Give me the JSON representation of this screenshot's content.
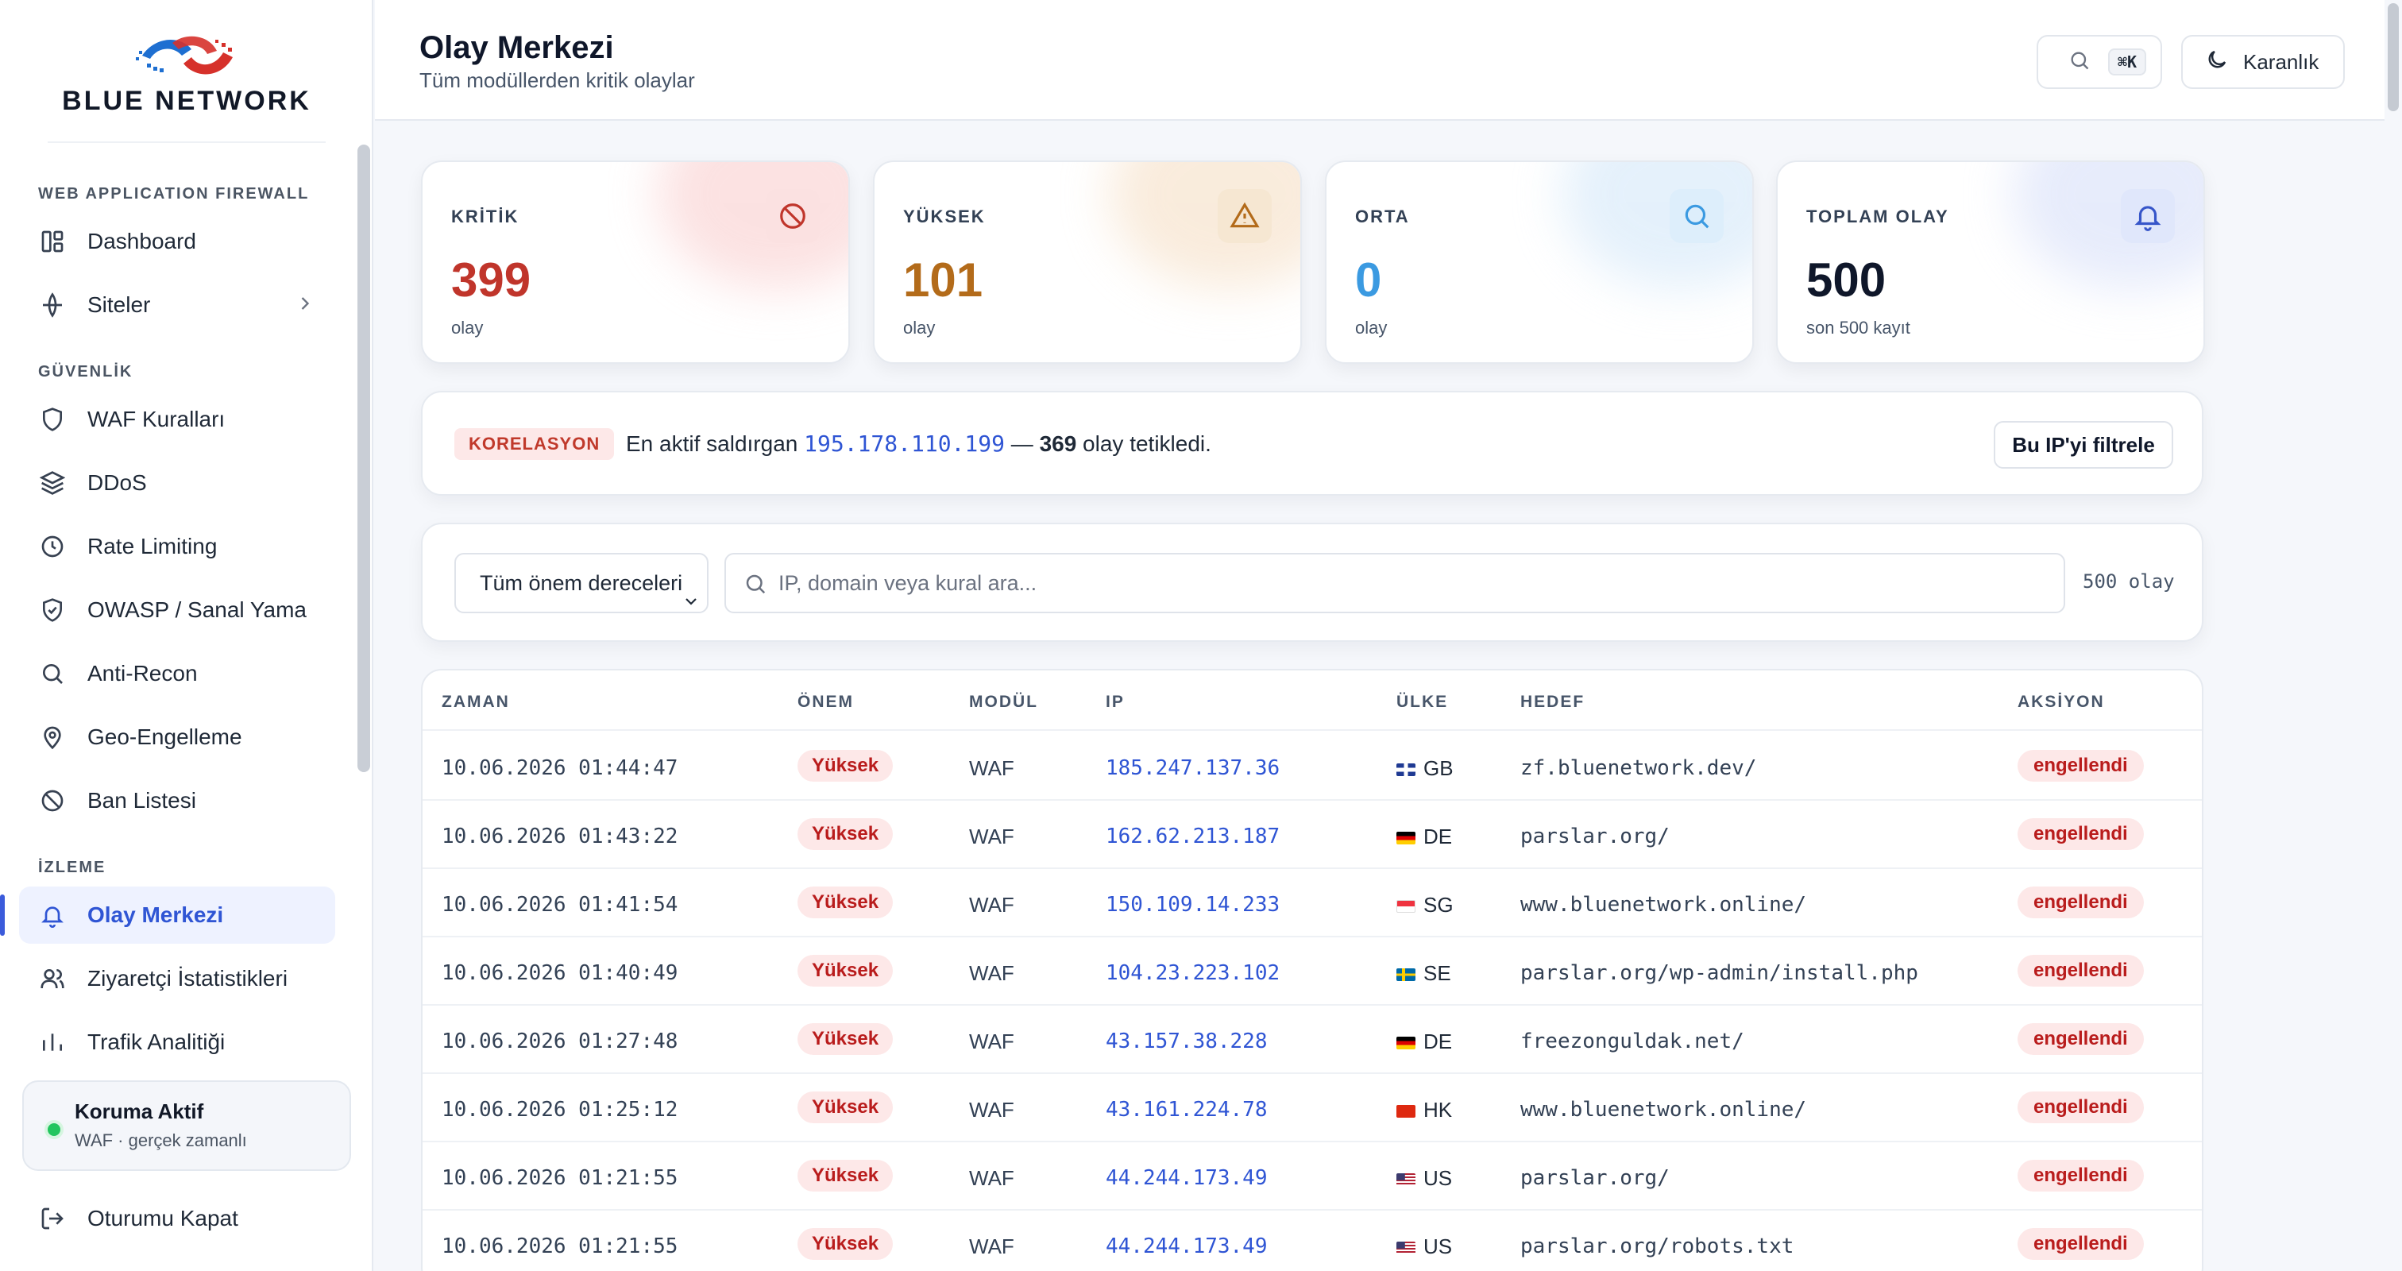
{
  "brand": {
    "name": "BLUE NETWORK"
  },
  "sidebar": {
    "sections": [
      {
        "title": "WEB APPLICATION FIREWALL",
        "items": [
          {
            "label": "Dashboard",
            "icon": "dashboard-icon"
          },
          {
            "label": "Siteler",
            "icon": "globe-icon",
            "has_children": true
          }
        ]
      },
      {
        "title": "GÜVENLİK",
        "items": [
          {
            "label": "WAF Kuralları",
            "icon": "shield-icon"
          },
          {
            "label": "DDoS",
            "icon": "layers-icon"
          },
          {
            "label": "Rate Limiting",
            "icon": "clock-icon"
          },
          {
            "label": "OWASP / Sanal Yama",
            "icon": "shield-check-icon"
          },
          {
            "label": "Anti-Recon",
            "icon": "search-icon"
          },
          {
            "label": "Geo-Engelleme",
            "icon": "map-pin-icon"
          },
          {
            "label": "Ban Listesi",
            "icon": "ban-icon"
          }
        ]
      },
      {
        "title": "İZLEME",
        "items": [
          {
            "label": "Olay Merkezi",
            "icon": "bell-icon",
            "active": true
          },
          {
            "label": "Ziyaretçi İstatistikleri",
            "icon": "users-icon"
          },
          {
            "label": "Trafik Analitiği",
            "icon": "chart-icon"
          }
        ]
      }
    ],
    "status": {
      "title": "Koruma Aktif",
      "subtitle": "WAF · gerçek zamanlı",
      "color": "#22c55e"
    },
    "logout_label": "Oturumu Kapat"
  },
  "header": {
    "title": "Olay Merkezi",
    "subtitle": "Tüm modüllerden kritik olaylar",
    "search_shortcut": "⌘K",
    "theme_label": "Karanlık"
  },
  "stats": [
    {
      "label": "KRİTİK",
      "value": "399",
      "sub": "olay",
      "color": "#c0352b",
      "icon": "ban-icon",
      "icon_bg": "#fbe1e1",
      "glow": "#f9caca"
    },
    {
      "label": "YÜKSEK",
      "value": "101",
      "sub": "olay",
      "color": "#b36b1a",
      "icon": "warning-icon",
      "icon_bg": "#f6e7d2",
      "glow": "#f5dcc0"
    },
    {
      "label": "ORTA",
      "value": "0",
      "sub": "olay",
      "color": "#3b9ae1",
      "icon": "search-icon",
      "icon_bg": "#ddeefb",
      "glow": "#cfe5f8"
    },
    {
      "label": "TOPLAM OLAY",
      "value": "500",
      "sub": "son 500 kayıt",
      "color": "#0f172a",
      "icon": "bell-icon",
      "icon_bg": "#e0e7fb",
      "glow": "#d3dcf8"
    }
  ],
  "correlation": {
    "tag": "KORELASYON",
    "text_before": "En aktif saldırgan ",
    "ip": "195.178.110.199",
    "text_mid": " — ",
    "count": "369",
    "text_after": " olay tetikledi.",
    "button_label": "Bu IP'yi filtrele"
  },
  "filter": {
    "severity_selected": "Tüm önem dereceleri",
    "search_placeholder": "IP, domain veya kural ara...",
    "count_label": "500 olay"
  },
  "table": {
    "columns": [
      "ZAMAN",
      "ÖNEM",
      "MODÜL",
      "IP",
      "ÜLKE",
      "HEDEF",
      "AKSİYON"
    ],
    "rows": [
      {
        "time": "10.06.2026 01:44:47",
        "severity": "Yüksek",
        "module": "WAF",
        "ip": "185.247.137.36",
        "country": "GB",
        "target": "zf.bluenetwork.dev/",
        "action": "engellendi"
      },
      {
        "time": "10.06.2026 01:43:22",
        "severity": "Yüksek",
        "module": "WAF",
        "ip": "162.62.213.187",
        "country": "DE",
        "target": "parslar.org/",
        "action": "engellendi"
      },
      {
        "time": "10.06.2026 01:41:54",
        "severity": "Yüksek",
        "module": "WAF",
        "ip": "150.109.14.233",
        "country": "SG",
        "target": "www.bluenetwork.online/",
        "action": "engellendi"
      },
      {
        "time": "10.06.2026 01:40:49",
        "severity": "Yüksek",
        "module": "WAF",
        "ip": "104.23.223.102",
        "country": "SE",
        "target": "parslar.org/wp-admin/install.php",
        "action": "engellendi"
      },
      {
        "time": "10.06.2026 01:27:48",
        "severity": "Yüksek",
        "module": "WAF",
        "ip": "43.157.38.228",
        "country": "DE",
        "target": "freezonguldak.net/",
        "action": "engellendi"
      },
      {
        "time": "10.06.2026 01:25:12",
        "severity": "Yüksek",
        "module": "WAF",
        "ip": "43.161.224.78",
        "country": "HK",
        "target": "www.bluenetwork.online/",
        "action": "engellendi"
      },
      {
        "time": "10.06.2026 01:21:55",
        "severity": "Yüksek",
        "module": "WAF",
        "ip": "44.244.173.49",
        "country": "US",
        "target": "parslar.org/",
        "action": "engellendi"
      },
      {
        "time": "10.06.2026 01:21:55",
        "severity": "Yüksek",
        "module": "WAF",
        "ip": "44.244.173.49",
        "country": "US",
        "target": "parslar.org/robots.txt",
        "action": "engellendi"
      }
    ]
  }
}
